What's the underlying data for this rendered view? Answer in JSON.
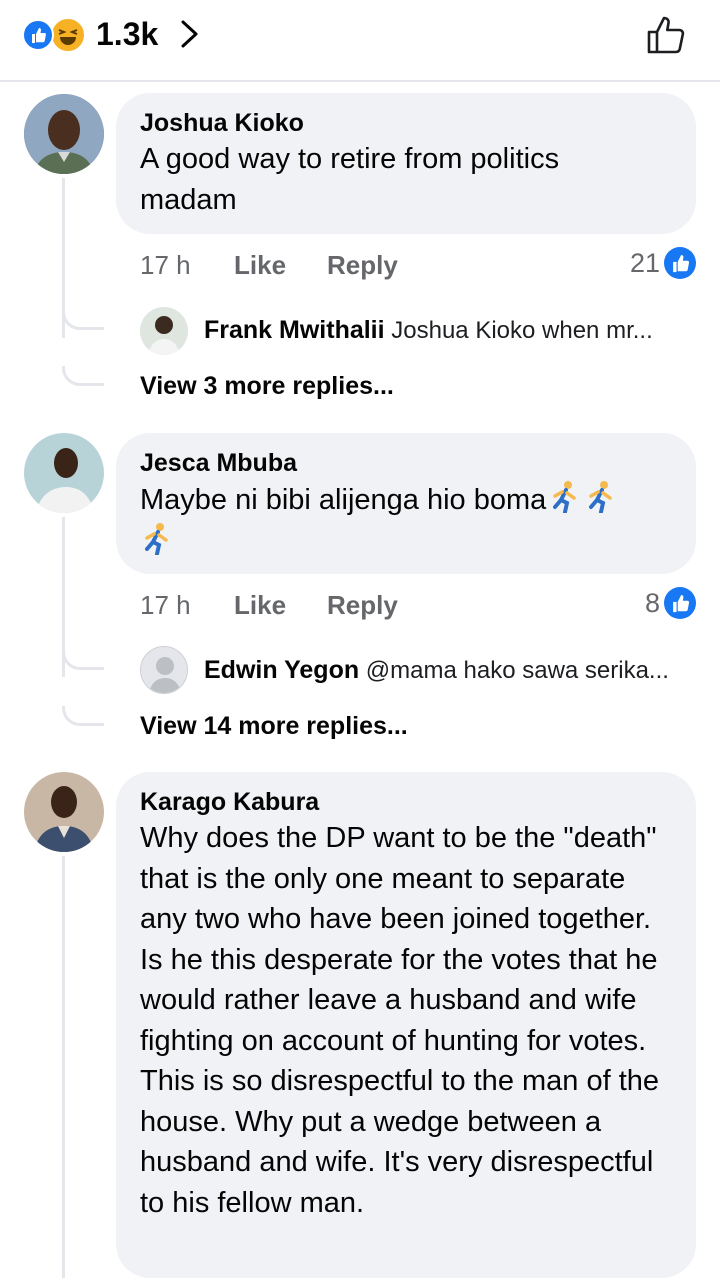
{
  "header": {
    "reaction_count": "1.3k",
    "icons": [
      "like-reaction-icon",
      "haha-reaction-icon",
      "chevron-right-icon",
      "thumbs-up-outline-icon"
    ],
    "colors": {
      "like_blue": "#1877f2",
      "haha_yellow": "#f7b125"
    }
  },
  "comments": [
    {
      "author": "Joshua Kioko",
      "text": "A good way to retire from politics madam",
      "time": "17 h",
      "like_label": "Like",
      "reply_label": "Reply",
      "reaction_count": "21",
      "reply_preview": {
        "author": "Frank Mwithalii",
        "text": "Joshua Kioko  when mr..."
      },
      "view_more": "View 3 more replies..."
    },
    {
      "author": "Jesca Mbuba",
      "text": "Maybe ni bibi alijenga hio boma",
      "emoji": [
        "running-man-emoji",
        "running-man-emoji",
        "running-man-emoji"
      ],
      "time": "17 h",
      "like_label": "Like",
      "reply_label": "Reply",
      "reaction_count": "8",
      "reply_preview": {
        "author": "Edwin Yegon",
        "text": "@mama hako sawa serika..."
      },
      "view_more": "View 14 more replies..."
    },
    {
      "author": "Karago Kabura",
      "text": "Why does the DP want to be the \"death\" that is the only one meant to separate any two who have been joined together. Is he this desperate for the votes that he would rather leave a husband and wife fighting on account of hunting for votes. This is so disrespectful to the man of the house. Why put a wedge between a husband and wife. It's very disrespectful to his fellow man."
    }
  ]
}
